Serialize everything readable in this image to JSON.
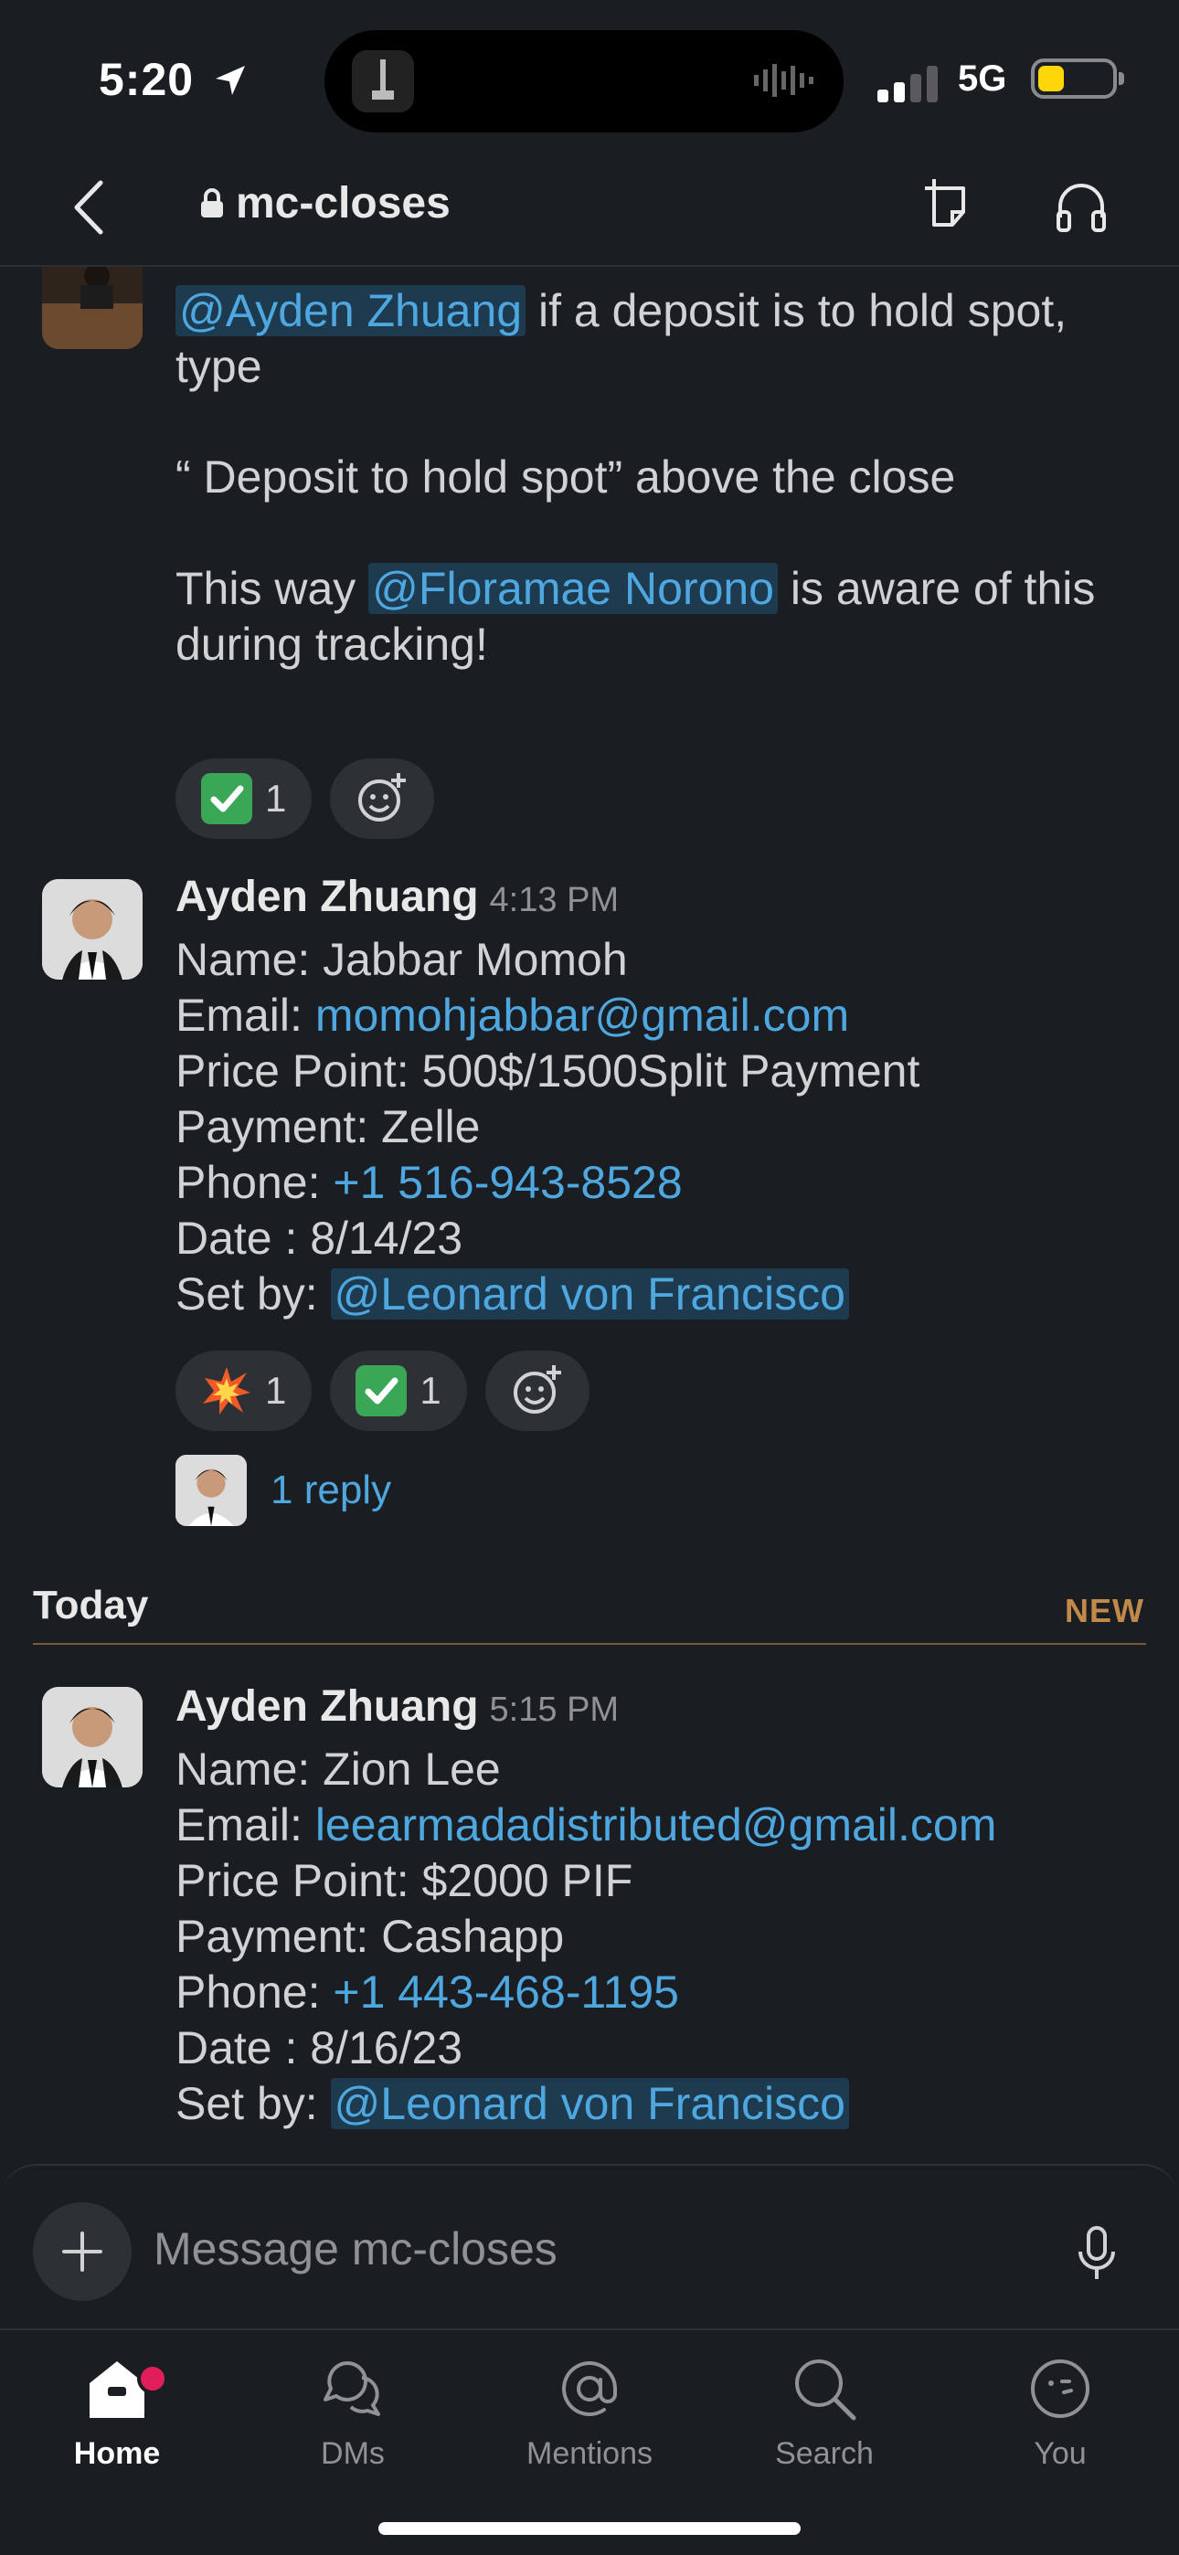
{
  "status_bar": {
    "time": "5:20",
    "network": "5G"
  },
  "header": {
    "channel_name": "mc-closes"
  },
  "messages": {
    "first": {
      "lines": {
        "l1_mention": "@Ayden Zhuang",
        "l1_rest": " if a deposit is to hold spot, type",
        "l2": "“ Deposit to hold spot” above the close",
        "l3_pre": "This way ",
        "l3_mention": "@Floramae Norono",
        "l3_rest": " is aware of this during tracking!"
      },
      "reactions": [
        {
          "emoji": "check-mark",
          "count": "1"
        }
      ]
    },
    "second": {
      "sender": "Ayden Zhuang",
      "time": "4:13 PM",
      "name_line": "Name: Jabbar Momoh",
      "email_label": "Email: ",
      "email": "momohjabbar@gmail.com",
      "price_line": "Price Point: 500$/1500Split Payment",
      "payment_line": "Payment: Zelle",
      "phone_label": "Phone: ",
      "phone": "+1 516-943-8528",
      "date_line": "Date : 8/14/23",
      "setby_label": "Set by: ",
      "setby": "@Leonard von Francisco",
      "reactions": [
        {
          "emoji": "collision",
          "count": "1"
        },
        {
          "emoji": "check-mark",
          "count": "1"
        }
      ],
      "replies": "1 reply"
    },
    "divider": {
      "label": "Today",
      "tag": "NEW"
    },
    "third": {
      "sender": "Ayden Zhuang",
      "time": "5:15 PM",
      "name_line": "Name: Zion Lee",
      "email_label": "Email: ",
      "email": "leearmadadistributed@gmail.com",
      "price_line": "Price Point: $2000 PIF",
      "payment_line": "Payment: Cashapp",
      "phone_label": "Phone: ",
      "phone": "+1 443-468-1195",
      "date_line": "Date : 8/16/23",
      "setby_label": "Set by: ",
      "setby": "@Leonard von Francisco"
    }
  },
  "composer": {
    "placeholder": "Message mc-closes"
  },
  "tabs": [
    {
      "label": "Home",
      "icon": "home-icon"
    },
    {
      "label": "DMs",
      "icon": "dm-icon"
    },
    {
      "label": "Mentions",
      "icon": "at-icon"
    },
    {
      "label": "Search",
      "icon": "search-icon"
    },
    {
      "label": "You",
      "icon": "you-icon"
    }
  ],
  "colors": {
    "link": "#4fa7e0",
    "mention_bg": "#1d3a4f",
    "new_divider": "#c18a4a",
    "badge": "#e01e5a"
  }
}
